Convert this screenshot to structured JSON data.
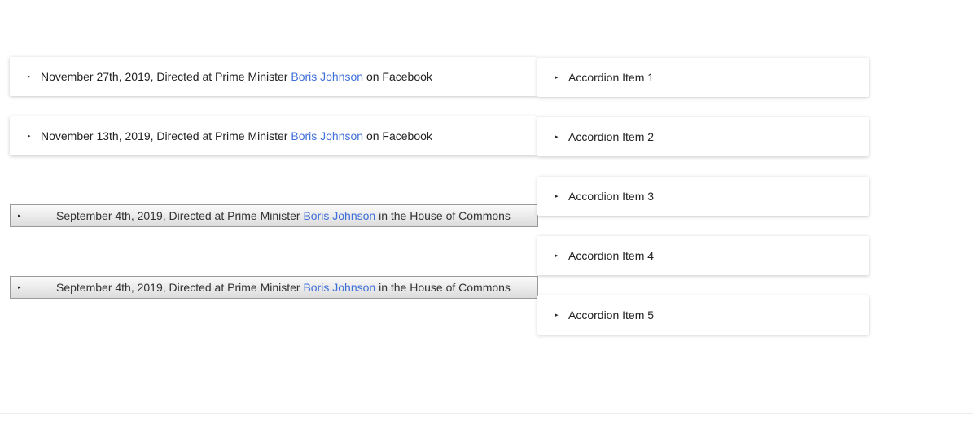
{
  "left_items": [
    {
      "prefix": "November 27th, 2019, Directed at Prime Minister ",
      "link": "Boris Johnson",
      "suffix": " on Facebook"
    },
    {
      "prefix": "November 13th, 2019, Directed at Prime Minister ",
      "link": "Boris Johnson",
      "suffix": " on Facebook"
    }
  ],
  "bars": [
    {
      "prefix": "September 4th, 2019, Directed at Prime Minister ",
      "link": "Boris Johnson",
      "suffix": " in the House of Commons"
    },
    {
      "prefix": "September 4th, 2019, Directed at Prime Minister ",
      "link": "Boris Johnson",
      "suffix": " in the House of Commons"
    }
  ],
  "accordion": [
    "Accordion Item 1",
    "Accordion Item 2",
    "Accordion Item 3",
    "Accordion Item 4",
    "Accordion Item 5"
  ],
  "arrow_glyph": "▸",
  "colors": {
    "link": "#3f6fd8"
  }
}
